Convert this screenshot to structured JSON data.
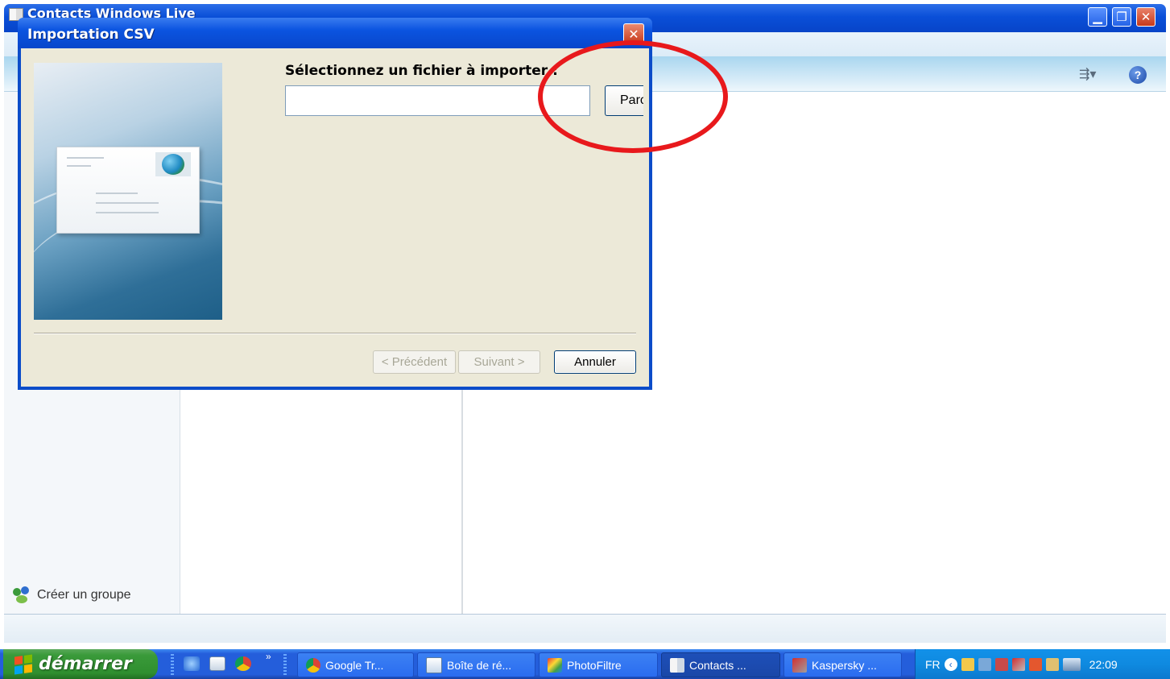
{
  "main_window": {
    "title": "Contacts Windows Live",
    "create_group_label": "Créer un groupe"
  },
  "dialog": {
    "title": "Importation CSV",
    "close_glyph": "✕",
    "prompt": "Sélectionnez un fichier à importer :",
    "file_value": "",
    "browse_label": "Parcourir...",
    "buttons": {
      "previous": "< Précédent",
      "next": "Suivant >",
      "cancel": "Annuler"
    }
  },
  "annotation": {
    "shape": "ellipse",
    "color": "#e8191c"
  },
  "taskbar": {
    "start_label": "démarrer",
    "tasks": [
      {
        "label": "Google Tr...",
        "icon": "chrome-icon"
      },
      {
        "label": "Boîte de ré...",
        "icon": "mail-icon"
      },
      {
        "label": "PhotoFiltre",
        "icon": "photofiltre-icon"
      },
      {
        "label": "Contacts ...",
        "icon": "contacts-icon",
        "active": true
      },
      {
        "label": "Kaspersky ...",
        "icon": "kaspersky-icon"
      }
    ],
    "language": "FR",
    "clock": "22:09"
  }
}
